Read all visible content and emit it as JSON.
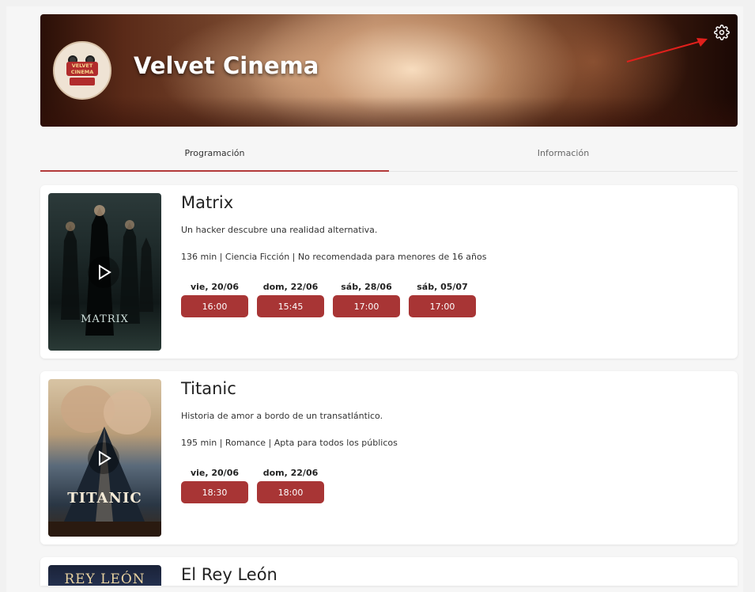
{
  "cinema": {
    "name": "Velvet Cinema",
    "logo_text": "VELVET CINEMA",
    "settings_icon": "gear-icon"
  },
  "tabs": [
    {
      "label": "Programación",
      "active": true
    },
    {
      "label": "Información",
      "active": false
    }
  ],
  "movies": [
    {
      "title": "Matrix",
      "poster_text": "MATRIX",
      "description": "Un hacker descubre una realidad alternativa.",
      "meta": "136 min | Ciencia Ficción | No recomendada para menores de 16 años",
      "showtimes": [
        {
          "date": "vie, 20/06",
          "time": "16:00"
        },
        {
          "date": "dom, 22/06",
          "time": "15:45"
        },
        {
          "date": "sáb, 28/06",
          "time": "17:00"
        },
        {
          "date": "sáb, 05/07",
          "time": "17:00"
        }
      ]
    },
    {
      "title": "Titanic",
      "poster_text": "TITANIC",
      "description": "Historia de amor a bordo de un transatlántico.",
      "meta": "195 min | Romance | Apta para todos los públicos",
      "showtimes": [
        {
          "date": "vie, 20/06",
          "time": "18:30"
        },
        {
          "date": "dom, 22/06",
          "time": "18:00"
        }
      ]
    },
    {
      "title": "El Rey León",
      "poster_text": "REY LEÓN"
    }
  ],
  "colors": {
    "accent": "#a83535",
    "tab_indicator": "#b33a3a",
    "arrow": "#e0201c"
  }
}
